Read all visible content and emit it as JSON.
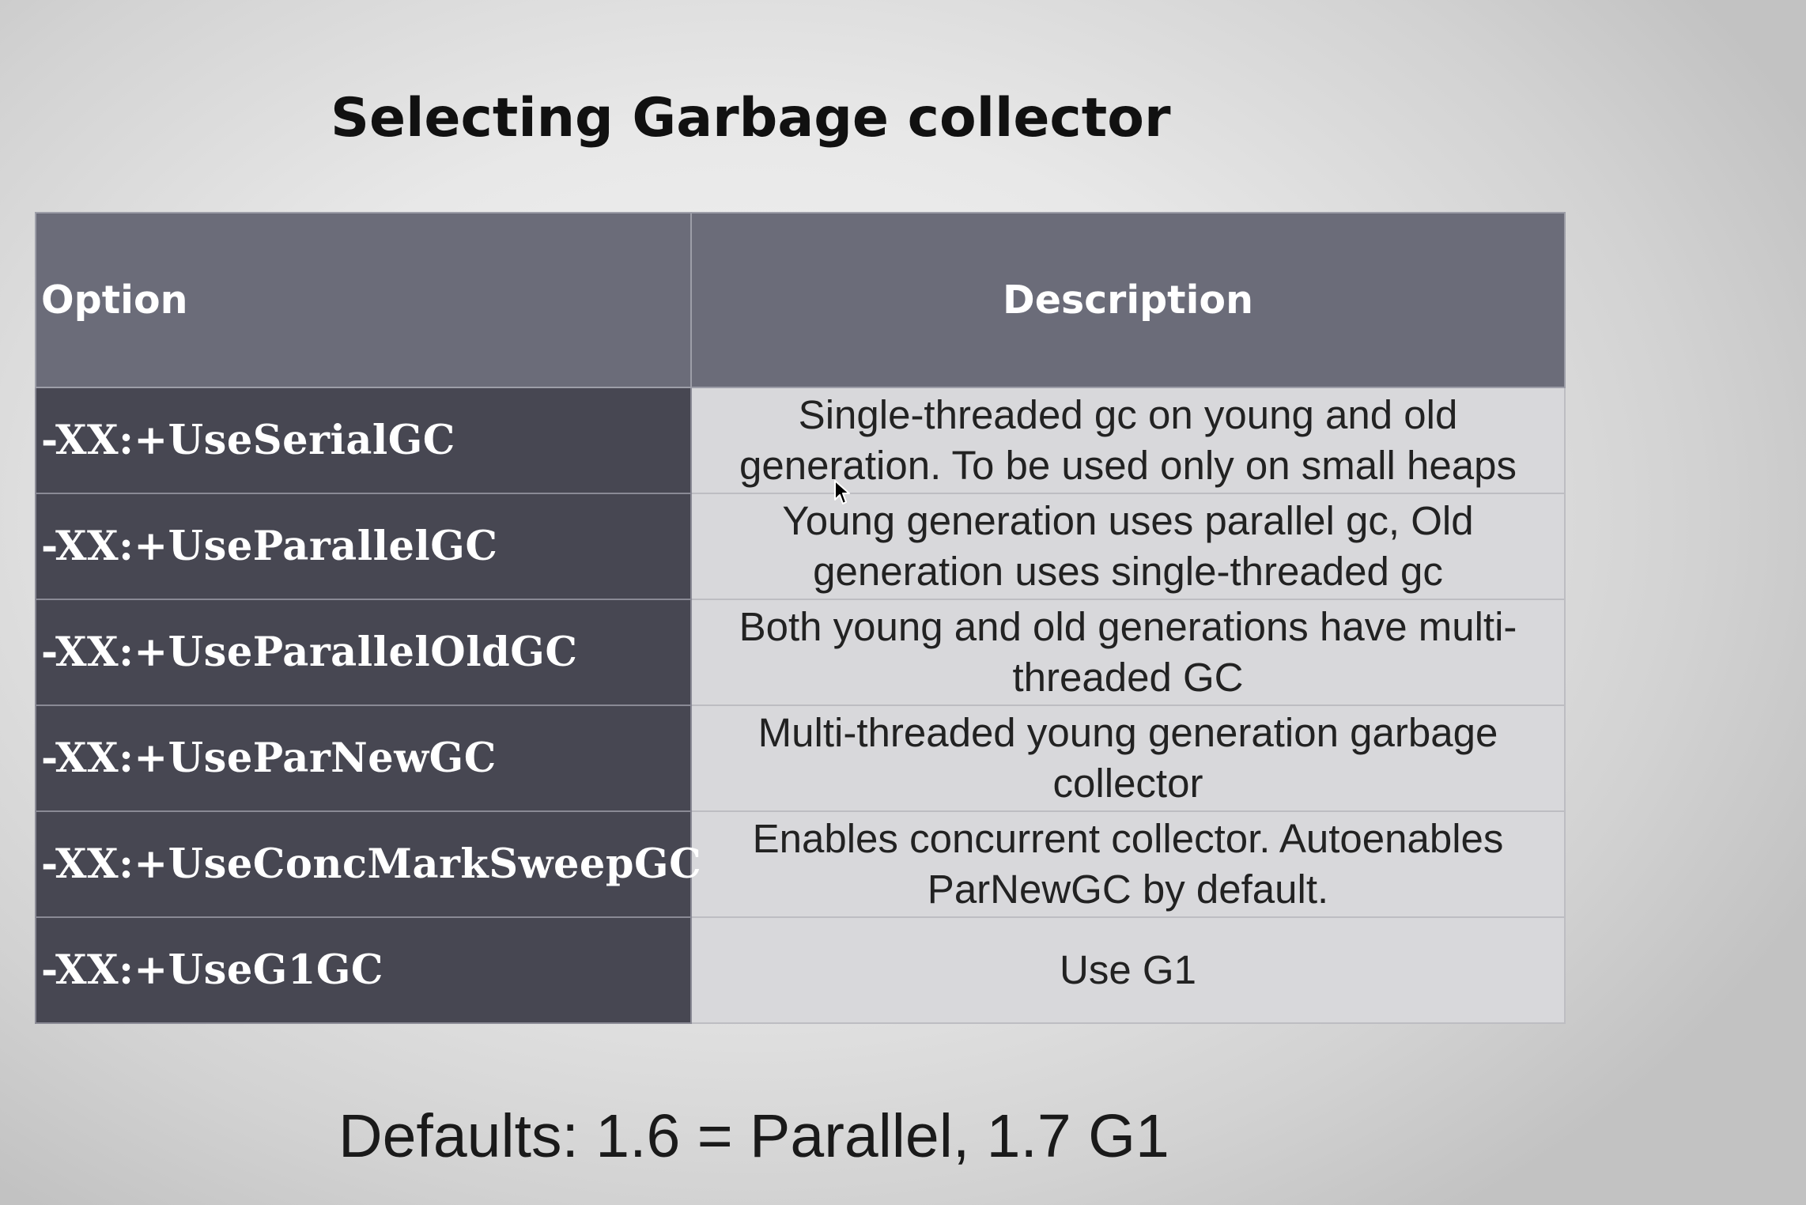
{
  "slide": {
    "title": "Selecting Garbage collector",
    "footer": "Defaults: 1.6 = Parallel, 1.7 G1"
  },
  "table": {
    "headers": {
      "option": "Option",
      "description": "Description"
    },
    "rows": [
      {
        "option": "-XX:+UseSerialGC",
        "description": "Single-threaded gc on young and old generation. To be used only on small heaps"
      },
      {
        "option": "-XX:+UseParallelGC",
        "description": "Young generation uses parallel gc, Old generation uses single-threaded gc"
      },
      {
        "option": "-XX:+UseParallelOldGC",
        "description": "Both young and old generations have multi-threaded GC"
      },
      {
        "option": "-XX:+UseParNewGC",
        "description": "Multi-threaded young generation garbage collector"
      },
      {
        "option": "-XX:+UseConcMarkSweepGC",
        "description": "Enables concurrent collector. Autoenables ParNewGC by default."
      },
      {
        "option": "-XX:+UseG1GC",
        "description": "Use G1"
      }
    ]
  },
  "colors": {
    "header_bg": "#6b6c79",
    "option_cell_bg": "#474752",
    "description_cell_bg": "#d8d8db",
    "background": "#e8e8e8"
  },
  "icons": {
    "cursor": "mouse-pointer-icon"
  }
}
